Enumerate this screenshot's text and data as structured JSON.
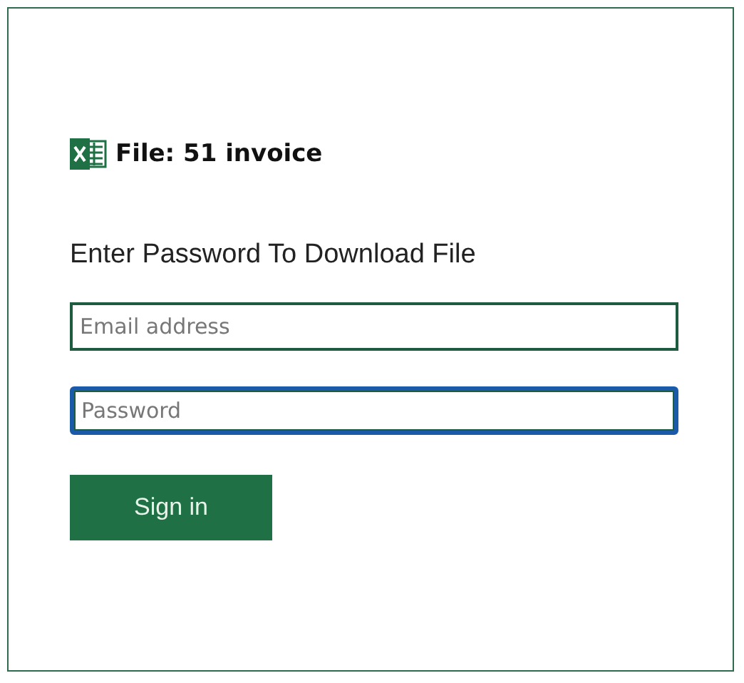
{
  "file_title": "File: 51 invoice",
  "heading": "Enter Password To Download File",
  "fields": [
    {
      "placeholder": "Email address",
      "focused": false
    },
    {
      "placeholder": "Password",
      "focused": true
    }
  ],
  "submit_button": "Sign in"
}
